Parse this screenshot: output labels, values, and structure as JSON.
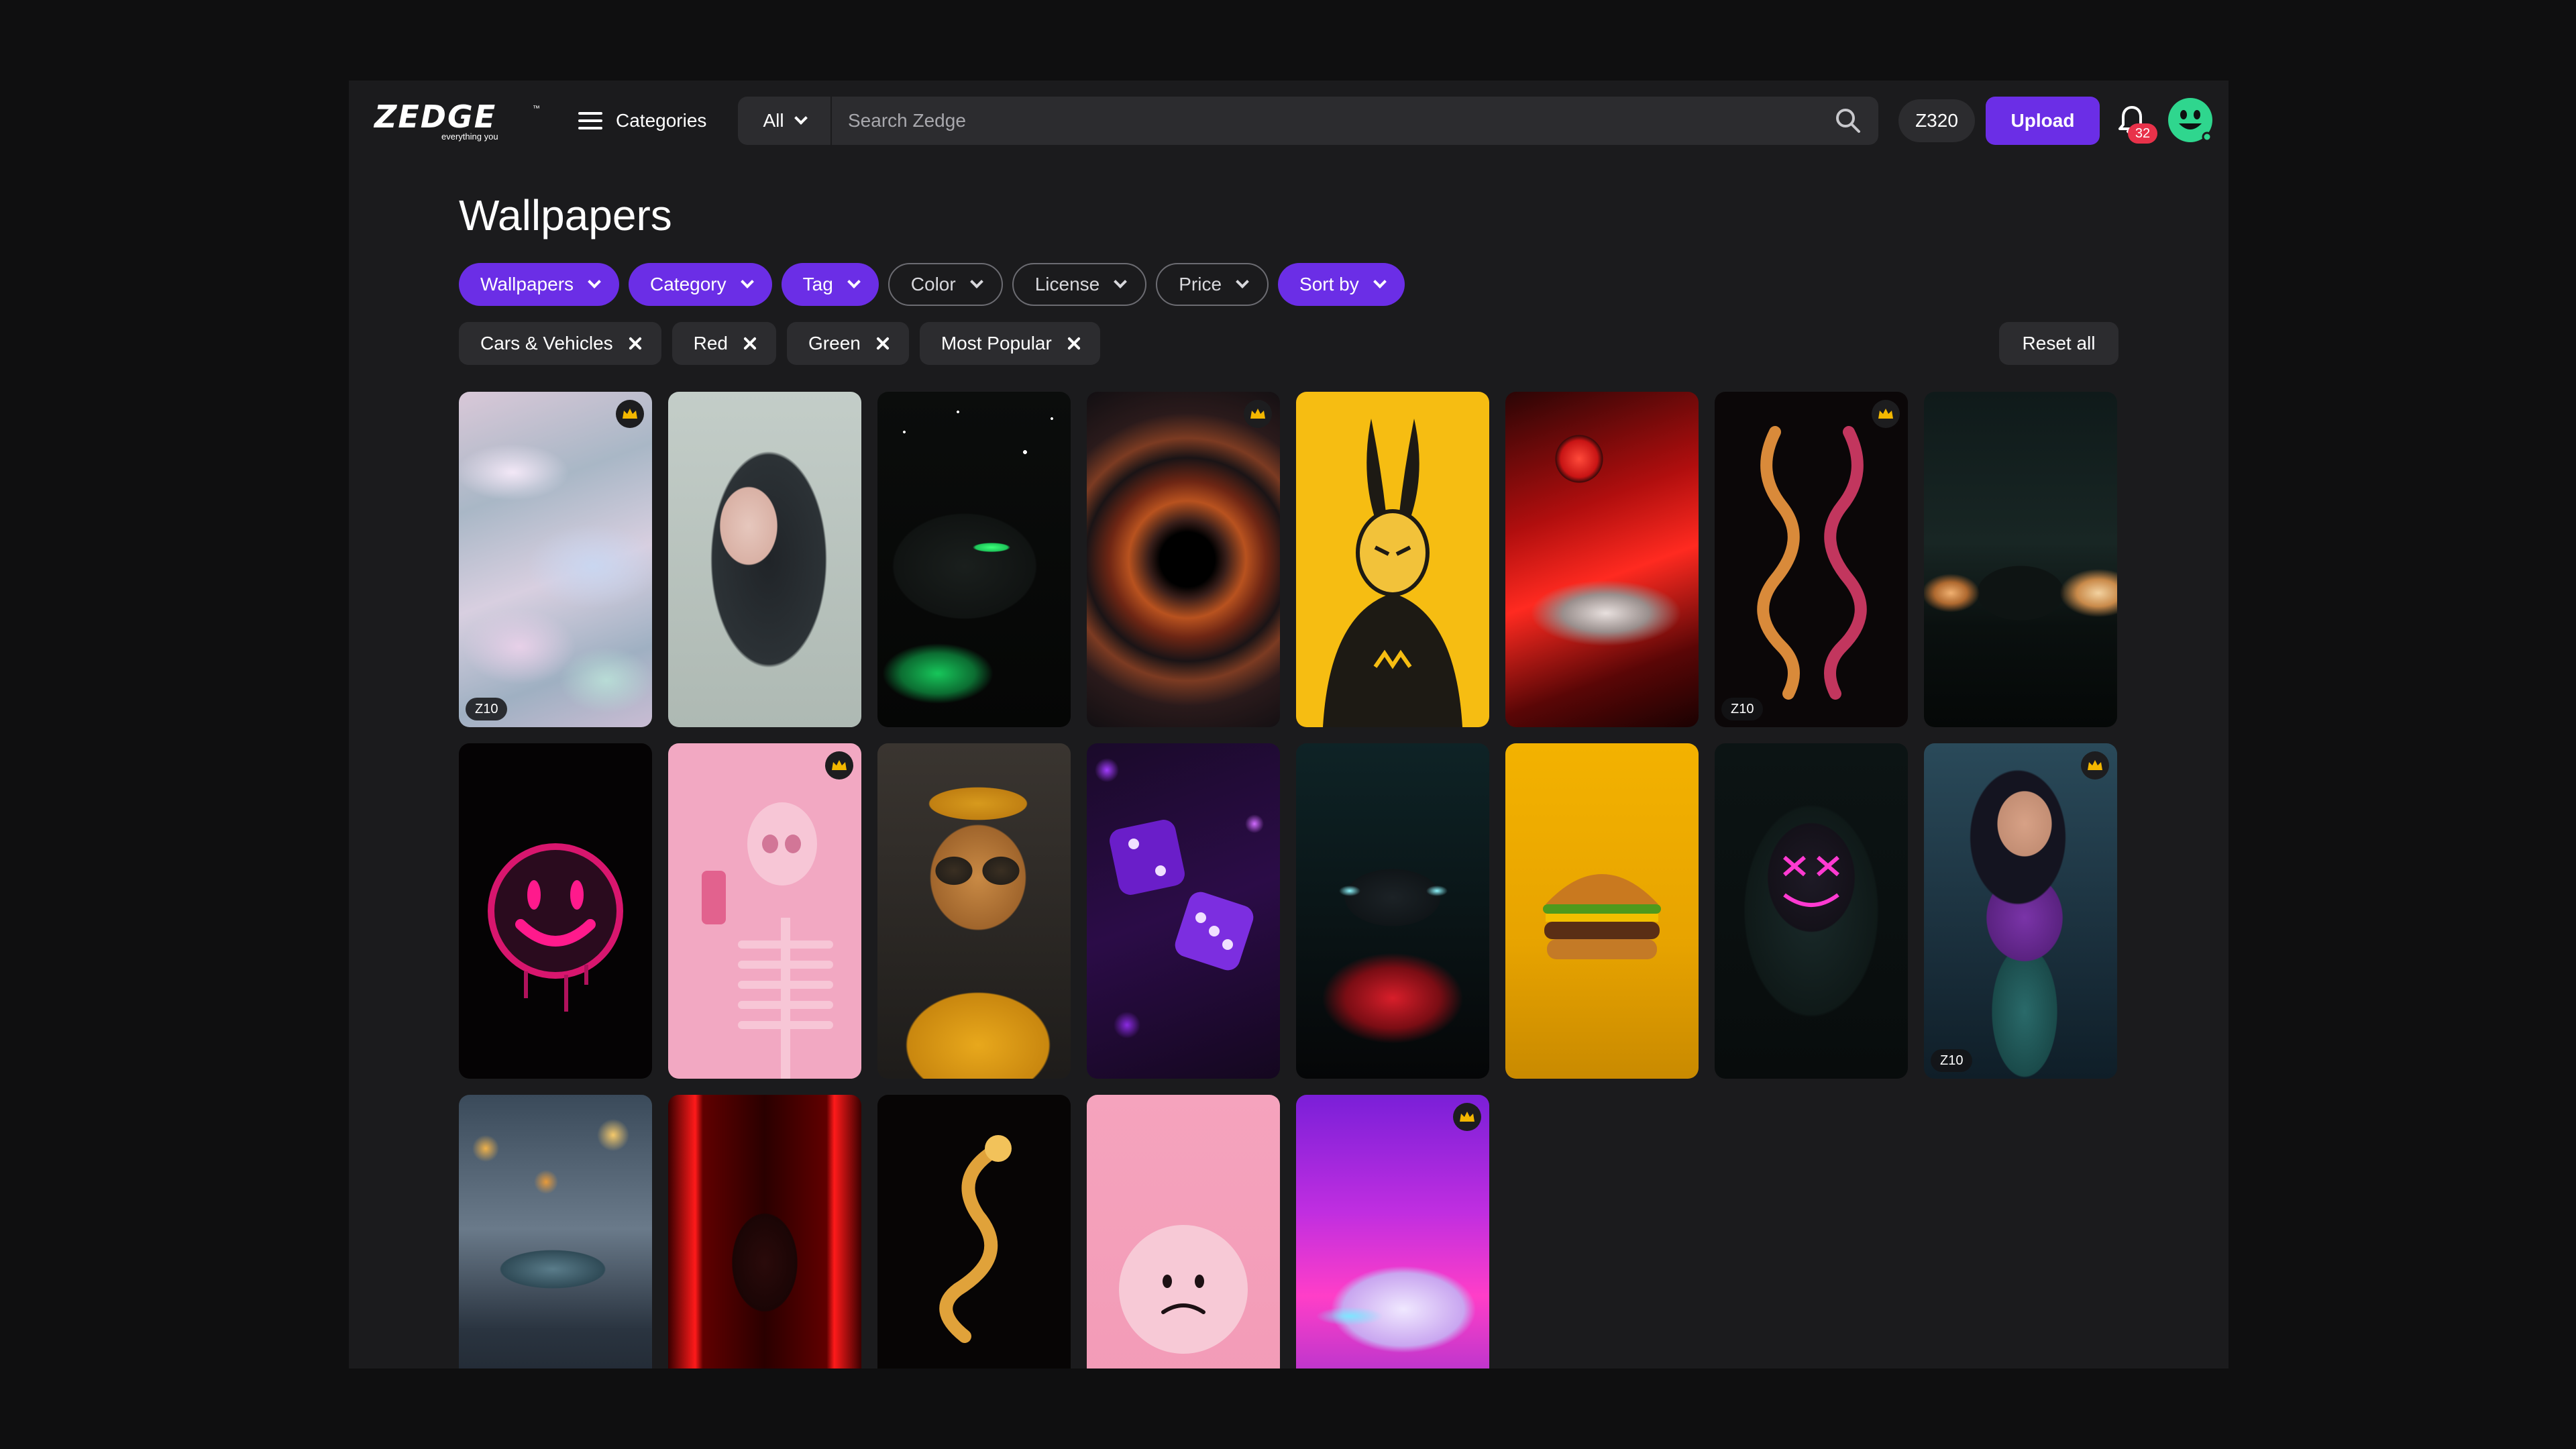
{
  "header": {
    "logo_text": "ZEDGE",
    "logo_tagline": "everything you",
    "logo_tm": "™",
    "categories_label": "Categories",
    "search_scope": "All",
    "search_placeholder": "Search Zedge",
    "zcoins": "Z320",
    "upload_label": "Upload",
    "notification_count": "32"
  },
  "page": {
    "title": "Wallpapers"
  },
  "filters": [
    {
      "label": "Wallpapers",
      "active": true
    },
    {
      "label": "Category",
      "active": true
    },
    {
      "label": "Tag",
      "active": true
    },
    {
      "label": "Color",
      "active": false
    },
    {
      "label": "License",
      "active": false
    },
    {
      "label": "Price",
      "active": false
    },
    {
      "label": "Sort by",
      "active": true
    }
  ],
  "chips": [
    "Cars & Vehicles",
    "Red",
    "Green",
    "Most Popular"
  ],
  "reset_label": "Reset all",
  "wallpapers": [
    {
      "subject": "iridescent liquid",
      "premium": true,
      "price": "Z10"
    },
    {
      "subject": "anime girl",
      "premium": false,
      "price": ""
    },
    {
      "subject": "green neon car",
      "premium": false,
      "price": ""
    },
    {
      "subject": "black hole",
      "premium": true,
      "price": ""
    },
    {
      "subject": "yellow rabbit",
      "premium": false,
      "price": ""
    },
    {
      "subject": "red classic car",
      "premium": false,
      "price": ""
    },
    {
      "subject": "twin dragons",
      "premium": true,
      "price": "Z10"
    },
    {
      "subject": "truck in smoke",
      "premium": false,
      "price": ""
    },
    {
      "subject": "pink smiley",
      "premium": false,
      "price": ""
    },
    {
      "subject": "pink skeleton",
      "premium": true,
      "price": ""
    },
    {
      "subject": "cool dog",
      "premium": false,
      "price": ""
    },
    {
      "subject": "purple dice",
      "premium": false,
      "price": ""
    },
    {
      "subject": "neon truck",
      "premium": false,
      "price": ""
    },
    {
      "subject": "burger",
      "premium": false,
      "price": ""
    },
    {
      "subject": "neon hood mask",
      "premium": false,
      "price": ""
    },
    {
      "subject": "comic heroine",
      "premium": true,
      "price": "Z10"
    },
    {
      "subject": "toy sports car",
      "premium": false,
      "price": ""
    },
    {
      "subject": "neon samurai",
      "premium": false,
      "price": ""
    },
    {
      "subject": "golden dragon",
      "premium": false,
      "price": ""
    },
    {
      "subject": "sad ball",
      "premium": false,
      "price": ""
    },
    {
      "subject": "neon car",
      "premium": true,
      "price": ""
    }
  ]
}
